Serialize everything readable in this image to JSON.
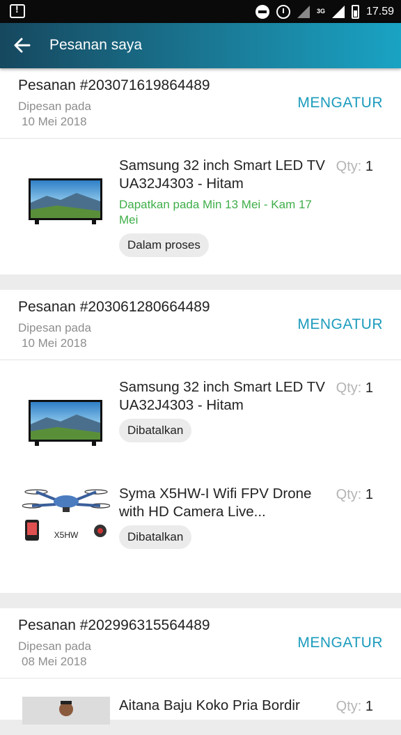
{
  "status_bar": {
    "time": "17.59",
    "network": "3G"
  },
  "app_bar": {
    "title": "Pesanan saya"
  },
  "orders": [
    {
      "number": "Pesanan #203071619864489",
      "ordered_label": "Dipesan pada",
      "ordered_date": "10 Mei 2018",
      "manage_label": "MENGATUR",
      "items": [
        {
          "name": "Samsung 32 inch Smart LED TV UA32J4303 - Hitam",
          "qty_label": "Qty:",
          "qty": "1",
          "eta": "Dapatkan pada Min 13 Mei - Kam 17 Mei",
          "status": "Dalam proses",
          "image": "tv"
        }
      ]
    },
    {
      "number": "Pesanan #203061280664489",
      "ordered_label": "Dipesan pada",
      "ordered_date": "10 Mei 2018",
      "manage_label": "MENGATUR",
      "items": [
        {
          "name": "Samsung 32 inch Smart LED TV UA32J4303 - Hitam",
          "qty_label": "Qty:",
          "qty": "1",
          "status": "Dibatalkan",
          "image": "tv"
        },
        {
          "name": "Syma X5HW-I Wifi FPV Drone with HD Camera Live...",
          "qty_label": "Qty:",
          "qty": "1",
          "status": "Dibatalkan",
          "image": "drone",
          "image_caption": "X5HW"
        }
      ]
    },
    {
      "number": "Pesanan #202996315564489",
      "ordered_label": "Dipesan pada",
      "ordered_date": "08 Mei 2018",
      "manage_label": "MENGATUR",
      "items": [
        {
          "name": "Aitana Baju Koko Pria Bordir",
          "qty_label": "Qty:",
          "qty": "1",
          "image": "shirt"
        }
      ]
    }
  ]
}
